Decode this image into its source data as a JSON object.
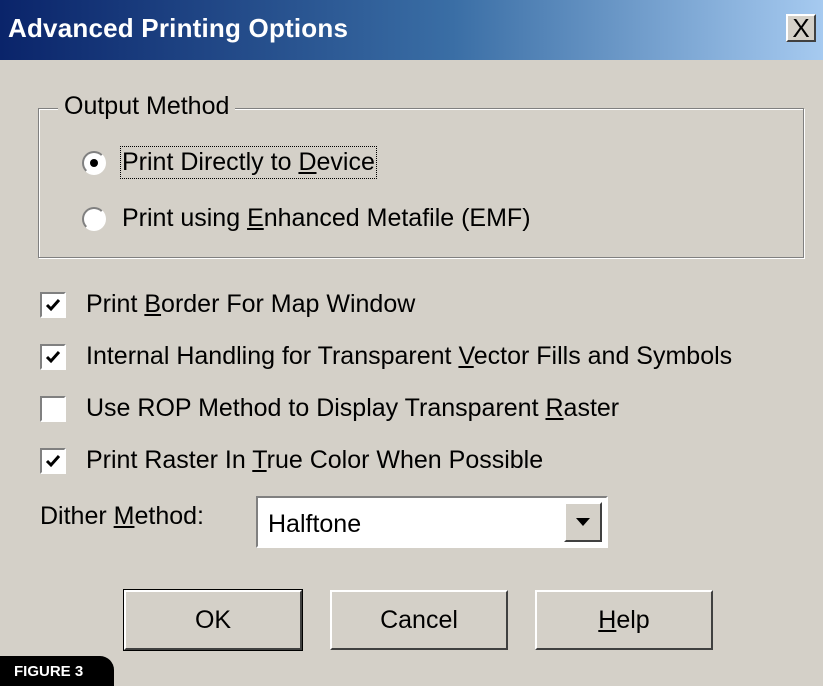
{
  "window": {
    "title": "Advanced Printing Options",
    "close_label": "X"
  },
  "output_method": {
    "legend": "Output Method",
    "options": [
      {
        "pre": "Print Directly to ",
        "key": "D",
        "post": "evice",
        "selected": true
      },
      {
        "pre": "Print using ",
        "key": "E",
        "post": "nhanced Metafile (EMF)",
        "selected": false
      }
    ]
  },
  "checkboxes": [
    {
      "pre": "Print ",
      "key": "B",
      "post": "order For Map Window",
      "checked": true
    },
    {
      "pre": "Internal Handling for Transparent ",
      "key": "V",
      "post": "ector Fills and Symbols",
      "checked": true
    },
    {
      "pre": "Use ROP Method to Display Transparent ",
      "key": "R",
      "post": "aster",
      "checked": false
    },
    {
      "pre": "Print Raster In ",
      "key": "T",
      "post": "rue Color When Possible",
      "checked": true
    }
  ],
  "dither": {
    "label_pre": "Dither ",
    "label_key": "M",
    "label_post": "ethod:",
    "value": "Halftone"
  },
  "buttons": {
    "ok": "OK",
    "cancel": "Cancel",
    "help_key": "H",
    "help_post": "elp"
  },
  "figure_tag": "FIGURE 3"
}
